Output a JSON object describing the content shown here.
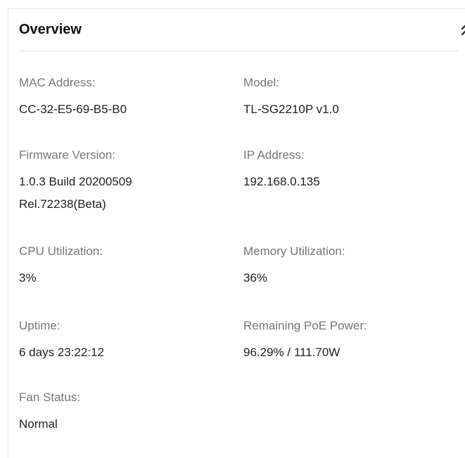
{
  "panel": {
    "title": "Overview",
    "collapse_icon": "double-chevron-up-icon"
  },
  "fields": {
    "mac": {
      "label": "MAC Address:",
      "value": "CC-32-E5-69-B5-B0"
    },
    "model": {
      "label": "Model:",
      "value": "TL-SG2210P v1.0"
    },
    "firmware": {
      "label": "Firmware Version:",
      "value_line1": "1.0.3 Build 20200509",
      "value_line2": "Rel.72238(Beta)"
    },
    "ip": {
      "label": "IP Address:",
      "value": "192.168.0.135"
    },
    "cpu": {
      "label": "CPU Utilization:",
      "value": "3%"
    },
    "memory": {
      "label": "Memory Utilization:",
      "value": "36%"
    },
    "uptime": {
      "label": "Uptime:",
      "value": "6 days 23:22:12"
    },
    "poe": {
      "label": "Remaining PoE Power:",
      "value": "96.29% / 111.70W"
    },
    "fan": {
      "label": "Fan Status:",
      "value": "Normal"
    }
  },
  "colors": {
    "label": "#777777",
    "value": "#222222",
    "title": "#111111",
    "divider": "#e3e3e3"
  }
}
